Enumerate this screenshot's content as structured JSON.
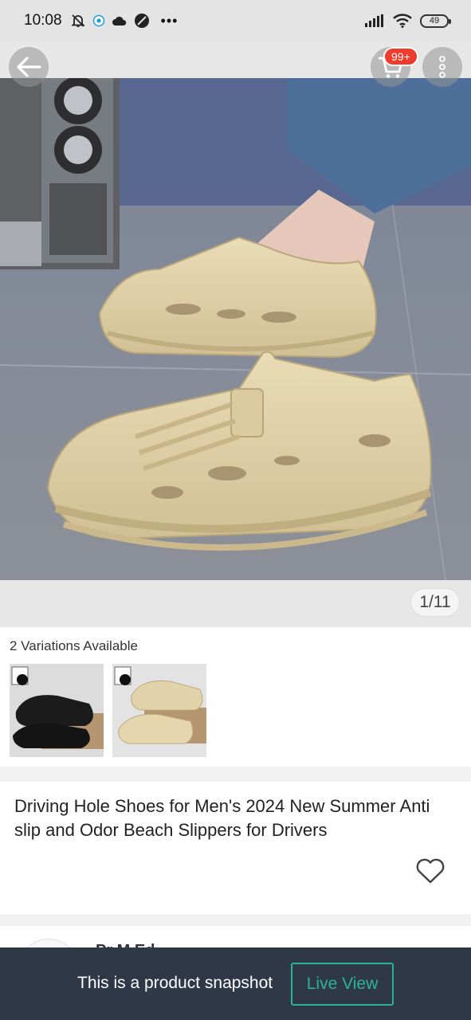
{
  "status_bar": {
    "time": "10:08",
    "battery": "49",
    "left_icons": [
      "muted-bell-icon",
      "browser-icon",
      "cloud-icon",
      "do-not-disturb-icon"
    ],
    "right_icons": [
      "signal-icon",
      "wifi-icon",
      "battery-icon"
    ]
  },
  "header": {
    "cart_badge": "99+",
    "buttons": [
      "back-arrow-icon",
      "shopping-cart-icon",
      "more-vertical-icon"
    ]
  },
  "gallery": {
    "counter": "1/11"
  },
  "variations": {
    "title": "2 Variations Available",
    "items": [
      {
        "color": "black"
      },
      {
        "color": "beige"
      }
    ]
  },
  "product": {
    "title": "Driving Hole Shoes for Men's 2024 New Summer Anti slip and Odor Beach Slippers for Drivers",
    "favorite_icon": "heart-icon"
  },
  "store": {
    "name": "Pr      M         Ed"
  },
  "snapshot_bar": {
    "message": "This is a product snapshot",
    "button_label": "Live View"
  },
  "colors": {
    "badge_red": "#ee3b2b",
    "bar_bg": "#2f3847",
    "accent_teal": "#2bb39a"
  }
}
